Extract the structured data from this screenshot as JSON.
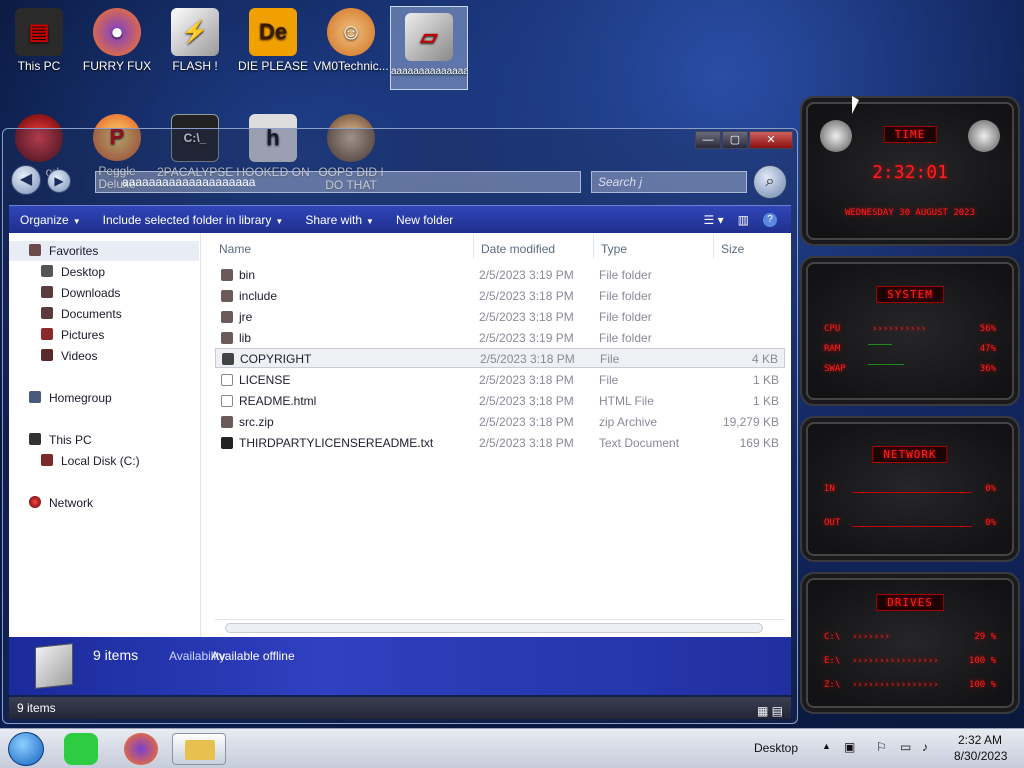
{
  "desktop_icons": [
    {
      "label": "This PC"
    },
    {
      "label": "FURRY FUX"
    },
    {
      "label": "FLASH !"
    },
    {
      "label": "DIE PLEASE"
    },
    {
      "label": "VM0Technic..."
    },
    {
      "label": "aaaaaaaaaaaaaaaaaaaa"
    },
    {
      "label": "ork"
    },
    {
      "label": "Peggle Deluxe"
    },
    {
      "label": "2PACALYPSE"
    },
    {
      "label": "HOOKED ON"
    },
    {
      "label": "OOPS DID I DO THAT"
    }
  ],
  "window": {
    "address": "aaaaaaaaaaaaaaaaaaaa",
    "search_placeholder": "Search j",
    "controls": {
      "minimize": "—",
      "maximize": "▢",
      "close": "✕"
    }
  },
  "toolbar": {
    "organize": "Organize",
    "include": "Include selected folder in library",
    "share": "Share with",
    "new_folder": "New folder"
  },
  "nav": {
    "favorites": "Favorites",
    "desktop": "Desktop",
    "downloads": "Downloads",
    "documents": "Documents",
    "pictures": "Pictures",
    "videos": "Videos",
    "homegroup": "Homegroup",
    "this_pc": "This PC",
    "local_disk": "Local Disk (C:)",
    "network": "Network"
  },
  "columns": {
    "name": "Name",
    "date": "Date modified",
    "type": "Type",
    "size": "Size"
  },
  "files": [
    {
      "name": "bin",
      "date": "2/5/2023 3:19 PM",
      "type": "File folder",
      "size": ""
    },
    {
      "name": "include",
      "date": "2/5/2023 3:18 PM",
      "type": "File folder",
      "size": ""
    },
    {
      "name": "jre",
      "date": "2/5/2023 3:18 PM",
      "type": "File folder",
      "size": ""
    },
    {
      "name": "lib",
      "date": "2/5/2023 3:19 PM",
      "type": "File folder",
      "size": ""
    },
    {
      "name": "COPYRIGHT",
      "date": "2/5/2023 3:18 PM",
      "type": "File",
      "size": "4 KB"
    },
    {
      "name": "LICENSE",
      "date": "2/5/2023 3:18 PM",
      "type": "File",
      "size": "1 KB"
    },
    {
      "name": "README.html",
      "date": "2/5/2023 3:18 PM",
      "type": "HTML File",
      "size": "1 KB"
    },
    {
      "name": "src.zip",
      "date": "2/5/2023 3:18 PM",
      "type": "zip Archive",
      "size": "19,279 KB"
    },
    {
      "name": "THIRDPARTYLICENSEREADME.txt",
      "date": "2/5/2023 3:18 PM",
      "type": "Text Document",
      "size": "169 KB"
    }
  ],
  "details": {
    "count": "9 items",
    "availability_label": "Availability:",
    "availability_value": "Available offline"
  },
  "status": {
    "items": "9 items"
  },
  "gadget": {
    "time_title": "TIME",
    "time": "2:32:01",
    "date": "WEDNESDAY 30 AUGUST 2023",
    "system_title": "SYSTEM",
    "cpu_label": "CPU",
    "cpu_value": "56%",
    "ram_label": "RAM",
    "ram_value": "47%",
    "swap_label": "SWAP",
    "swap_value": "36%",
    "network_title": "NETWORK",
    "in_label": "IN",
    "in_value": "0%",
    "out_label": "OUT",
    "out_value": "0%",
    "drives_title": "DRIVES",
    "d1_label": "C:\\",
    "d1_value": "29 %",
    "d2_label": "E:\\",
    "d2_value": "100 %",
    "d3_label": "Z:\\",
    "d3_value": "100 %"
  },
  "taskbar": {
    "desktop": "Desktop",
    "time": "2:32 AM",
    "date": "8/30/2023"
  }
}
